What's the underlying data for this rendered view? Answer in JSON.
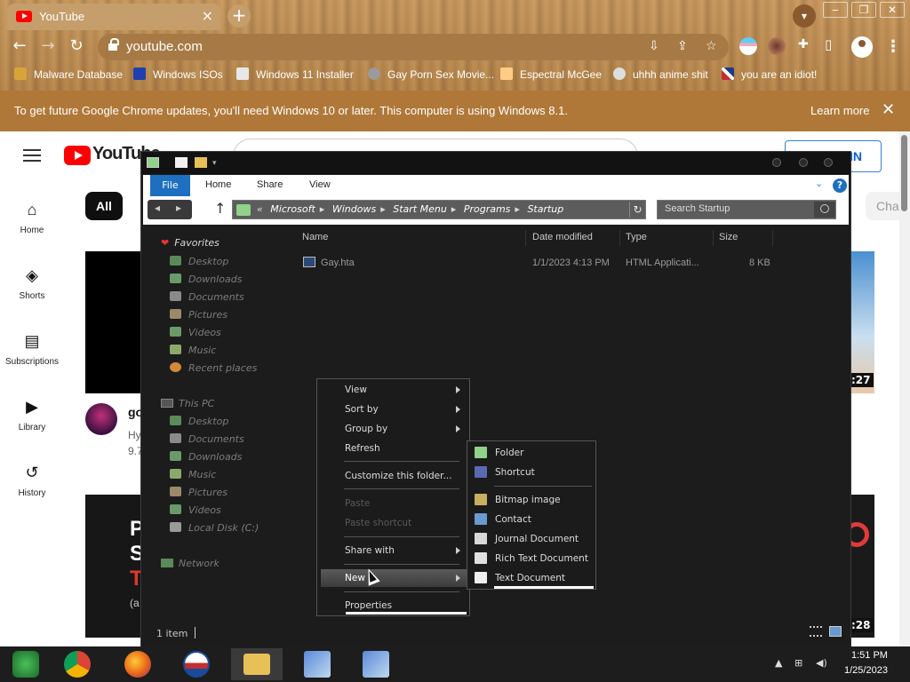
{
  "browser": {
    "tab_title": "YouTube",
    "new_tab": "+",
    "window_controls": {
      "minimize": "‒",
      "restore": "❐",
      "close": "✕"
    },
    "url": "youtube.com",
    "bookmarks": [
      {
        "label": "Malware Database",
        "icon": "bug-icon",
        "color": "#d8a43a"
      },
      {
        "label": "Windows ISOs",
        "icon": "x-icon",
        "color": "#1f3fb0"
      },
      {
        "label": "Windows 11 Installer",
        "icon": "image-icon",
        "color": "#e8e8e8"
      },
      {
        "label": "Gay Porn Sex Movie...",
        "icon": "gear-icon",
        "color": "#9a9a9a"
      },
      {
        "label": "Espectral McGee",
        "icon": "person-icon",
        "color": "#ffcc88"
      },
      {
        "label": "uhhh anime shit",
        "icon": "anime-icon",
        "color": "#dddddd"
      },
      {
        "label": "you are an idiot!",
        "icon": "flag-icon",
        "color": "#c03030"
      }
    ],
    "infobar": {
      "message": "To get future Google Chrome updates, you'll need Windows 10 or later. This computer is using Windows 8.1.",
      "action": "Learn more",
      "close": "✕"
    }
  },
  "youtube": {
    "logo_text": "YouTube",
    "sign_in": "IN",
    "sidebar": [
      {
        "label": "Home",
        "icon": "home-icon",
        "glyph": "⌂"
      },
      {
        "label": "Shorts",
        "icon": "shorts-icon",
        "glyph": "◈"
      },
      {
        "label": "Subscriptions",
        "icon": "subscriptions-icon",
        "glyph": "▤"
      },
      {
        "label": "Library",
        "icon": "library-icon",
        "glyph": "▶"
      },
      {
        "label": "History",
        "icon": "history-icon",
        "glyph": "↺"
      }
    ],
    "chips": {
      "all": "All",
      "right": "Cha"
    },
    "video1": {
      "title": "go",
      "channel": "Hy",
      "views": "9.7",
      "duration": ":27"
    },
    "video2": {
      "thumb_lines": [
        "P",
        "S"
      ],
      "thumb_red": "T",
      "thumb_small": "(a",
      "duration": ":28"
    }
  },
  "explorer": {
    "ribbon": {
      "file": "File",
      "tabs": [
        "Home",
        "Share",
        "View"
      ],
      "help": "?"
    },
    "breadcrumb": {
      "prefix": "«",
      "parts": [
        "Microsoft",
        "Windows",
        "Start Menu",
        "Programs",
        "Startup"
      ]
    },
    "search_placeholder": "Search Startup",
    "nav_pane": {
      "favorites": {
        "label": "Favorites",
        "items": [
          {
            "label": "Desktop",
            "color": "#5a8a5a"
          },
          {
            "label": "Downloads",
            "color": "#6a9a6a"
          },
          {
            "label": "Documents",
            "color": "#8a8a8a"
          },
          {
            "label": "Pictures",
            "color": "#9a8a6a"
          },
          {
            "label": "Videos",
            "color": "#6a9a6a"
          },
          {
            "label": "Music",
            "color": "#8aaa6a"
          },
          {
            "label": "Recent places",
            "color": "#d08a3a"
          }
        ]
      },
      "this_pc": {
        "label": "This PC",
        "items": [
          {
            "label": "Desktop",
            "color": "#5a8a5a"
          },
          {
            "label": "Documents",
            "color": "#8a8a8a"
          },
          {
            "label": "Downloads",
            "color": "#6a9a6a"
          },
          {
            "label": "Music",
            "color": "#8aaa6a"
          },
          {
            "label": "Pictures",
            "color": "#9a8a6a"
          },
          {
            "label": "Videos",
            "color": "#6a9a6a"
          },
          {
            "label": "Local Disk (C:)",
            "color": "#9a9a9a"
          }
        ]
      },
      "network": {
        "label": "Network"
      }
    },
    "columns": [
      "Name",
      "Date modified",
      "Type",
      "Size"
    ],
    "files": [
      {
        "name": "Gay.hta",
        "date": "1/1/2023 4:13 PM",
        "type": "HTML Applicati...",
        "size": "8 KB"
      }
    ],
    "status": "1 item"
  },
  "context_menu": {
    "items": [
      {
        "label": "View",
        "submenu": true,
        "disabled": false
      },
      {
        "label": "Sort by",
        "submenu": true,
        "disabled": false
      },
      {
        "label": "Group by",
        "submenu": true,
        "disabled": false
      },
      {
        "label": "Refresh",
        "submenu": false,
        "disabled": false
      },
      {
        "label": "Customize this folder...",
        "submenu": false,
        "disabled": false
      },
      {
        "label": "Paste",
        "submenu": false,
        "disabled": true
      },
      {
        "label": "Paste shortcut",
        "submenu": false,
        "disabled": true
      },
      {
        "label": "Share with",
        "submenu": true,
        "disabled": false
      },
      {
        "label": "New",
        "submenu": true,
        "disabled": false,
        "highlighted": true
      },
      {
        "label": "Properties",
        "submenu": false,
        "disabled": false
      }
    ],
    "new_submenu": [
      {
        "label": "Folder",
        "icon": "folder-icon",
        "color": "#8fd28a"
      },
      {
        "label": "Shortcut",
        "icon": "shortcut-icon",
        "color": "#5a6ab0"
      },
      {
        "label": "Bitmap image",
        "icon": "bitmap-icon",
        "color": "#c8b060"
      },
      {
        "label": "Contact",
        "icon": "contact-icon",
        "color": "#6a9ad0"
      },
      {
        "label": "Journal Document",
        "icon": "journal-icon",
        "color": "#d8d8d8"
      },
      {
        "label": "Rich Text Document",
        "icon": "rtf-icon",
        "color": "#e0e0e0"
      },
      {
        "label": "Text Document",
        "icon": "text-doc-icon",
        "color": "#f0f0f0"
      }
    ]
  },
  "taskbar": {
    "apps": [
      {
        "name": "Media Center",
        "icon": "media-center-icon",
        "color": "#2a8a3a"
      },
      {
        "name": "Google Chrome",
        "icon": "chrome-icon",
        "color": "#db4437"
      },
      {
        "name": "Firefox",
        "icon": "firefox-icon",
        "color": "#e8651a"
      },
      {
        "name": "Obama",
        "icon": "obama-logo-icon",
        "color": "#1a4a9a"
      },
      {
        "name": "File Explorer",
        "icon": "file-explorer-icon",
        "color": "#e8c058"
      },
      {
        "name": "Setup 1",
        "icon": "setup-icon",
        "color": "#5a8ad8"
      },
      {
        "name": "Setup 2",
        "icon": "setup-icon",
        "color": "#5a8ad8"
      }
    ],
    "clock": {
      "time": "1:51 PM",
      "date": "1/25/2023"
    }
  }
}
